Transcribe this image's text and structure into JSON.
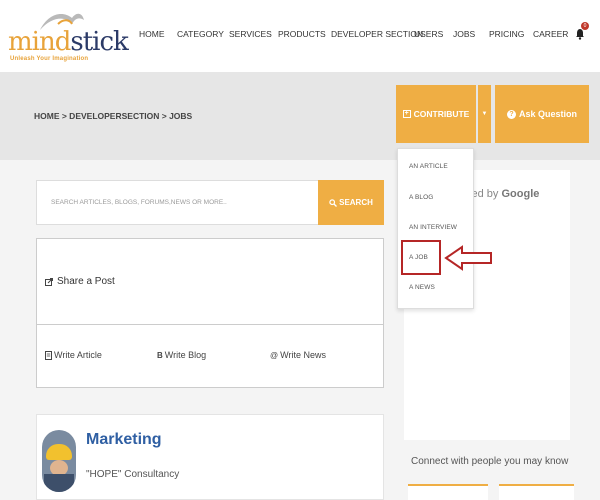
{
  "brand": {
    "logo_part1": "mind",
    "logo_part2": "stick",
    "tagline": "Unleash Your Imagination"
  },
  "nav": {
    "items": [
      {
        "label": "HOME"
      },
      {
        "label": "CATEGORY"
      },
      {
        "label": "SERVICES"
      },
      {
        "label": "PRODUCTS"
      },
      {
        "label": "DEVELOPER SECTION"
      },
      {
        "label": "USERS"
      },
      {
        "label": "JOBS"
      },
      {
        "label": "PRICING"
      },
      {
        "label": "CAREER"
      }
    ],
    "notification_count": "0"
  },
  "breadcrumb": {
    "text": "HOME > DEVELOPERSECTION > JOBS"
  },
  "actions": {
    "contribute_label": "CONTRIBUTE",
    "ask_label": "Ask Question"
  },
  "contribute_menu": {
    "items": [
      {
        "label": "AN ARTICLE"
      },
      {
        "label": "A BLOG"
      },
      {
        "label": "AN INTERVIEW"
      },
      {
        "label": "A JOB"
      },
      {
        "label": "A NEWS"
      }
    ],
    "highlighted": "A JOB"
  },
  "search": {
    "placeholder": "SEARCH ARTICLES, BLOGS, FORUMS,NEWS OR MORE..",
    "button_label": "SEARCH"
  },
  "share": {
    "title": "Share a Post",
    "write_article": "Write Article",
    "write_blog": "Write Blog",
    "write_news": "Write News"
  },
  "job_post": {
    "title": "Marketing",
    "company": "\"HOPE\" Consultancy"
  },
  "sidebar": {
    "powered_prefix": "sed by",
    "powered_brand": "Google",
    "connect_title": "Connect with people you may know"
  },
  "colors": {
    "accent": "#efae44",
    "link": "#2f5fa3",
    "highlight": "#b52626"
  }
}
